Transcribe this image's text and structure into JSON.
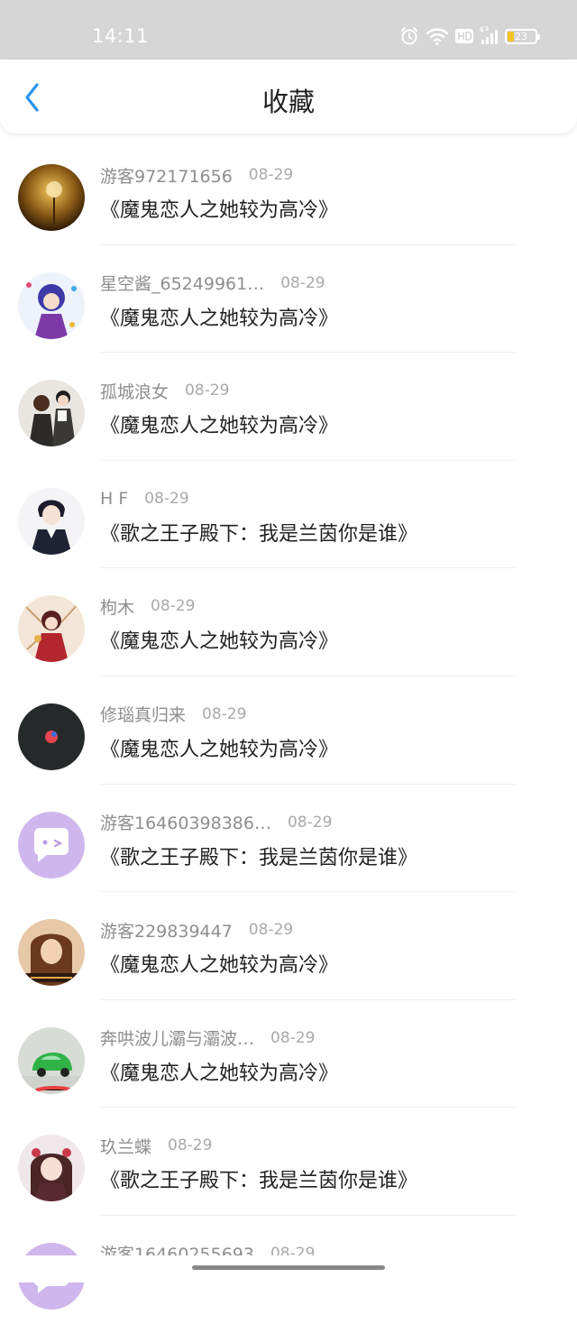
{
  "status_bar": {
    "time": "14:11",
    "battery": "23",
    "battery_level": 0.23
  },
  "header": {
    "title": "收藏"
  },
  "items": [
    {
      "username": "游客972171656",
      "date": "08-29",
      "title": "《魔鬼恋人之她较为高冷》"
    },
    {
      "username": "星空酱_65249961…",
      "date": "08-29",
      "title": "《魔鬼恋人之她较为高冷》"
    },
    {
      "username": "孤城浪女",
      "date": "08-29",
      "title": "《魔鬼恋人之她较为高冷》"
    },
    {
      "username": "H F",
      "date": "08-29",
      "title": "《歌之王子殿下：我是兰茵你是谁》"
    },
    {
      "username": "枸木",
      "date": "08-29",
      "title": "《魔鬼恋人之她较为高冷》"
    },
    {
      "username": "修瑙真归来",
      "date": "08-29",
      "title": "《魔鬼恋人之她较为高冷》"
    },
    {
      "username": "游客16460398386…",
      "date": "08-29",
      "title": "《歌之王子殿下：我是兰茵你是谁》"
    },
    {
      "username": "游客229839447",
      "date": "08-29",
      "title": "《魔鬼恋人之她较为高冷》"
    },
    {
      "username": "奔哄波儿灞与灞波…",
      "date": "08-29",
      "title": "《魔鬼恋人之她较为高冷》"
    },
    {
      "username": "玖兰蝶",
      "date": "08-29",
      "title": "《歌之王子殿下：我是兰茵你是谁》"
    },
    {
      "username": "游客16460255693",
      "date": "08-29",
      "title": ""
    }
  ],
  "colors": {
    "accent": "#2a95f0",
    "username": "#8e8e8e",
    "date": "#a9a9a9",
    "title": "#222222"
  }
}
